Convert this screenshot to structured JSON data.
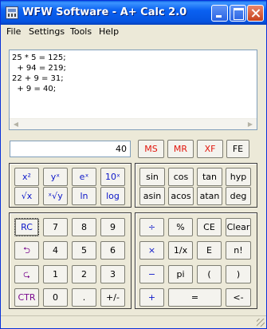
{
  "window": {
    "title": "WFW Software - A+ Calc 2.0"
  },
  "menu": {
    "items": [
      "File",
      "Settings",
      "Tools",
      "Help"
    ]
  },
  "log": {
    "lines": [
      "25 * 5 = 125;",
      "  + 94 = 219;",
      "22 + 9 = 31;",
      "  + 9 = 40;"
    ]
  },
  "display": {
    "value": "40"
  },
  "memory": {
    "ms": "MS",
    "mr": "MR",
    "xf": "XF",
    "fe": "FE"
  },
  "sci": {
    "x_sq": "x²",
    "y_pow_x": "yˣ",
    "e_pow_x": "eˣ",
    "ten_pow_x": "10ˣ",
    "sqrt_x": "√x",
    "xroot_y": "ˣ√y",
    "ln": "ln",
    "log": "log"
  },
  "trig": {
    "sin": "sin",
    "cos": "cos",
    "tan": "tan",
    "hyp": "hyp",
    "asin": "asin",
    "acos": "acos",
    "atan": "atan",
    "deg": "deg"
  },
  "keypad": {
    "rc": "RC",
    "undo": "⮌",
    "redo": "⮎",
    "ctr": "CTR",
    "d7": "7",
    "d8": "8",
    "d9": "9",
    "d4": "4",
    "d5": "5",
    "d6": "6",
    "d1": "1",
    "d2": "2",
    "d3": "3",
    "d0": "0",
    "dot": ".",
    "sign": "+/-"
  },
  "ops": {
    "div": "÷",
    "pct": "%",
    "ce": "CE",
    "clear": "Clear",
    "mul": "×",
    "recip": "1/x",
    "e": "E",
    "fact": "n!",
    "sub": "−",
    "pi": "pi",
    "lparen": "(",
    "rparen": ")",
    "add": "+",
    "eq": "=",
    "back": "<-"
  }
}
